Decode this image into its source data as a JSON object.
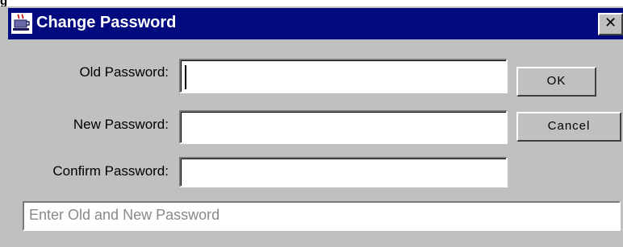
{
  "background_fragment": "g",
  "dialog": {
    "title": "Change Password",
    "title_bar_color": "#010a7f",
    "icon": "coffee-cup-icon",
    "close_label": "✕"
  },
  "fields": {
    "old_password": {
      "label": "Old Password:",
      "value": ""
    },
    "new_password": {
      "label": "New Password:",
      "value": ""
    },
    "confirm_password": {
      "label": "Confirm Password:",
      "value": ""
    }
  },
  "buttons": {
    "ok_label": "OK",
    "cancel_label": "Cancel"
  },
  "status": {
    "message": "Enter Old and New Password"
  }
}
